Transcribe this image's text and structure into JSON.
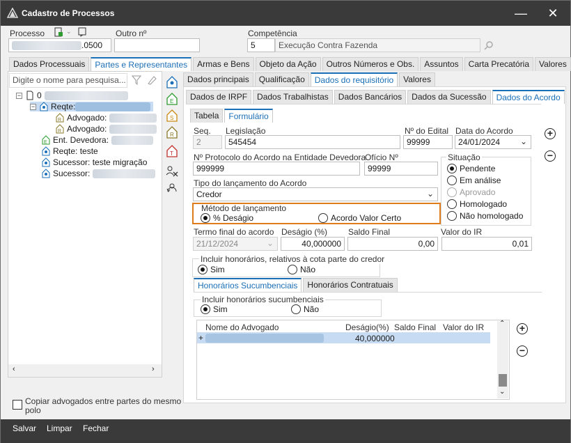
{
  "window": {
    "title": "Cadastro de Processos"
  },
  "header": {
    "processo_label": "Processo",
    "processo_value": ".0500",
    "outro_label": "Outro nº",
    "outro_value": "",
    "competencia_label": "Competência",
    "competencia_code": "5",
    "competencia_desc": "Execução Contra Fazenda"
  },
  "main_tabs": [
    "Dados Processuais",
    "Partes e Representantes",
    "Armas e Bens",
    "Objeto da Ação",
    "Outros Números e Obs.",
    "Assuntos",
    "Carta Precatória",
    "Valores"
  ],
  "search": {
    "placeholder": "Digite o nome para pesquisa..."
  },
  "tree": {
    "root": "0",
    "items": [
      {
        "label": "Reqte: ",
        "level": 1,
        "selected": true
      },
      {
        "label": "Advogado:",
        "level": 2
      },
      {
        "label": "Advogado:",
        "level": 2
      },
      {
        "label": "Ent. Devedora:",
        "level": 1
      },
      {
        "label": "Reqte: teste",
        "level": 1
      },
      {
        "label": "Sucessor: teste  migração",
        "level": 1
      },
      {
        "label": "Sucessor:",
        "level": 1
      }
    ]
  },
  "copy_checkbox": {
    "label": "Copiar advogados entre partes do mesmo polo"
  },
  "sub_tabs": [
    "Dados principais",
    "Qualificação",
    "Dados do requisitório",
    "Valores"
  ],
  "req_tabs": [
    "Dados de IRPF",
    "Dados Trabalhistas",
    "Dados Bancários",
    "Dados da Sucessão",
    "Dados do Acordo"
  ],
  "view_tabs": [
    "Tabela",
    "Formulário"
  ],
  "form": {
    "seq_label": "Seq.",
    "seq_value": "2",
    "legislacao_label": "Legislação",
    "legislacao_value": "545454",
    "edital_label": "Nº do Edital",
    "edital_value": "99999",
    "data_acordo_label": "Data do Acordo",
    "data_acordo_value": "24/01/2024",
    "protocolo_label": "Nº Protocolo do Acordo na Entidade Devedora",
    "protocolo_value": "999999",
    "oficio_label": "Ofício Nº",
    "oficio_value": "99999",
    "situacao_label": "Situação",
    "situacao_options": [
      "Pendente",
      "Em análise",
      "Aprovado",
      "Homologado",
      "Não homologado"
    ],
    "tipo_label": "Tipo do lançamento do Acordo",
    "tipo_value": "Credor",
    "metodo_label": "Método de lançamento",
    "metodo_options": [
      "% Deságio",
      "Acordo Valor Certo"
    ],
    "termo_label": "Termo final do acordo",
    "termo_value": "21/12/2024",
    "desagio_label": "Deságio (%)",
    "desagio_value": "40,000000",
    "saldo_label": "Saldo Final",
    "saldo_value": "0,00",
    "ir_label": "Valor do IR",
    "ir_value": "0,01",
    "incluir_cred_label": "Incluir honorários, relativos à cota parte do credor",
    "yes": "Sim",
    "no": "Não"
  },
  "hon_tabs": [
    "Honorários Sucumbenciais",
    "Honorários Contratuais"
  ],
  "hon": {
    "incluir_label": "Incluir honorários sucumbenciais",
    "columns": [
      "Nome do Advogado",
      "Deságio(%)",
      "Saldo Final",
      "Valor do IR"
    ],
    "rows": [
      {
        "marker": "+",
        "desagio": "40,000000"
      }
    ]
  },
  "footer": {
    "save": "Salvar",
    "clear": "Limpar",
    "close": "Fechar"
  },
  "colors": {
    "titlebar": "#3a3a3a",
    "accent": "#1b6fb7",
    "highlight": "#e07b1c",
    "selection": "#c7dcf2"
  }
}
